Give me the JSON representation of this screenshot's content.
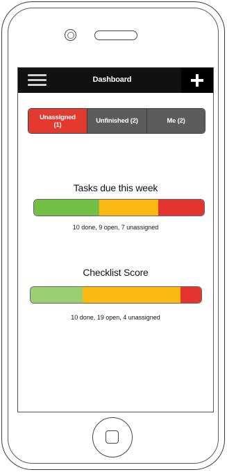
{
  "header": {
    "title": "Dashboard",
    "menu_icon": "hamburger-menu-icon",
    "add_icon": "plus-icon"
  },
  "tabs": [
    {
      "label": "Unassigned",
      "count": "(1)",
      "active": true
    },
    {
      "label": "Unfinished (2)",
      "active": false
    },
    {
      "label": "Me (2)",
      "active": false
    }
  ],
  "tasks_due": {
    "title": "Tasks due this week",
    "summary": "10 done, 9 open, 7 unassigned",
    "done": 10,
    "open": 9,
    "unassigned": 7,
    "colors": {
      "done": "#74c046",
      "open": "#fdb913",
      "unassigned": "#e3342f"
    }
  },
  "checklist": {
    "title": "Checklist Score",
    "summary": "10 done, 19 open, 4 unassigned",
    "done": 10,
    "open": 19,
    "unassigned": 4,
    "colors": {
      "done": "#9ccf72",
      "open": "#fdb913",
      "unassigned": "#e3342f"
    }
  },
  "colors": {
    "topbar": "#111111",
    "tab_active": "#e33a30",
    "tab_inactive": "#5c5c5c"
  }
}
